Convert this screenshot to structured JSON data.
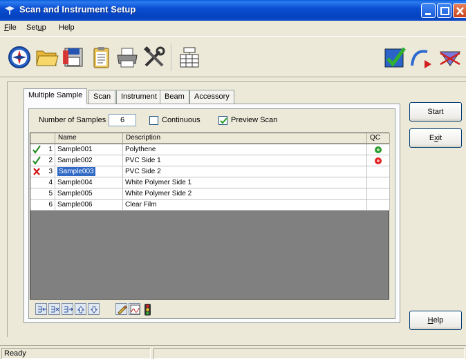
{
  "window": {
    "title": "Scan and Instrument Setup"
  },
  "menu": [
    {
      "label": "File",
      "accel": "F",
      "rest": "ile"
    },
    {
      "label": "Setup",
      "accel": "u",
      "pre": "Set",
      "rest": "p"
    },
    {
      "label": "Help",
      "accel": "",
      "rest": "Help"
    }
  ],
  "toolbar": {
    "icons": [
      "compass-icon",
      "open-folder-icon",
      "save-disk-icon",
      "clipboard-icon",
      "printer-icon",
      "tools-icon",
      "table-config-icon",
      "check-calibration-icon",
      "arc-arrow-icon",
      "prism-icon"
    ]
  },
  "tabs": [
    "Multiple Sample",
    "Scan",
    "Instrument",
    "Beam",
    "Accessory"
  ],
  "form": {
    "num_samples_label": "Number of Samples",
    "num_samples_value": "6",
    "continuous_label": "Continuous",
    "continuous_checked": false,
    "preview_label": "Preview Scan",
    "preview_checked": true
  },
  "table": {
    "headers": [
      "",
      "Name",
      "Description",
      "QC"
    ],
    "rows": [
      {
        "status": "check",
        "index": "1",
        "name": "Sample001",
        "description": "Polythene",
        "qc": "green"
      },
      {
        "status": "check",
        "index": "2",
        "name": "Sample002",
        "description": "PVC Side 1",
        "qc": "red"
      },
      {
        "status": "cross",
        "index": "3",
        "name": "Sample003",
        "description": "PVC Side 2",
        "qc": ""
      },
      {
        "status": "",
        "index": "4",
        "name": "Sample004",
        "description": "White Polymer Side 1",
        "qc": ""
      },
      {
        "status": "",
        "index": "5",
        "name": "Sample005",
        "description": "White Polymer Side 2",
        "qc": ""
      },
      {
        "status": "",
        "index": "6",
        "name": "Sample006",
        "description": "Clear Film",
        "qc": ""
      }
    ],
    "selected_row": 3
  },
  "buttons": {
    "start": "Start",
    "exit_pre": "E",
    "exit_accel": "x",
    "exit_rest": "it",
    "help_accel": "H",
    "help_rest": "elp"
  },
  "status": {
    "text": "Ready"
  },
  "colors": {
    "qc_green": "#2e9b2e",
    "qc_red": "#e02020",
    "selection": "#316ac5",
    "check": "#1a8a1a",
    "cross": "#d01010"
  }
}
